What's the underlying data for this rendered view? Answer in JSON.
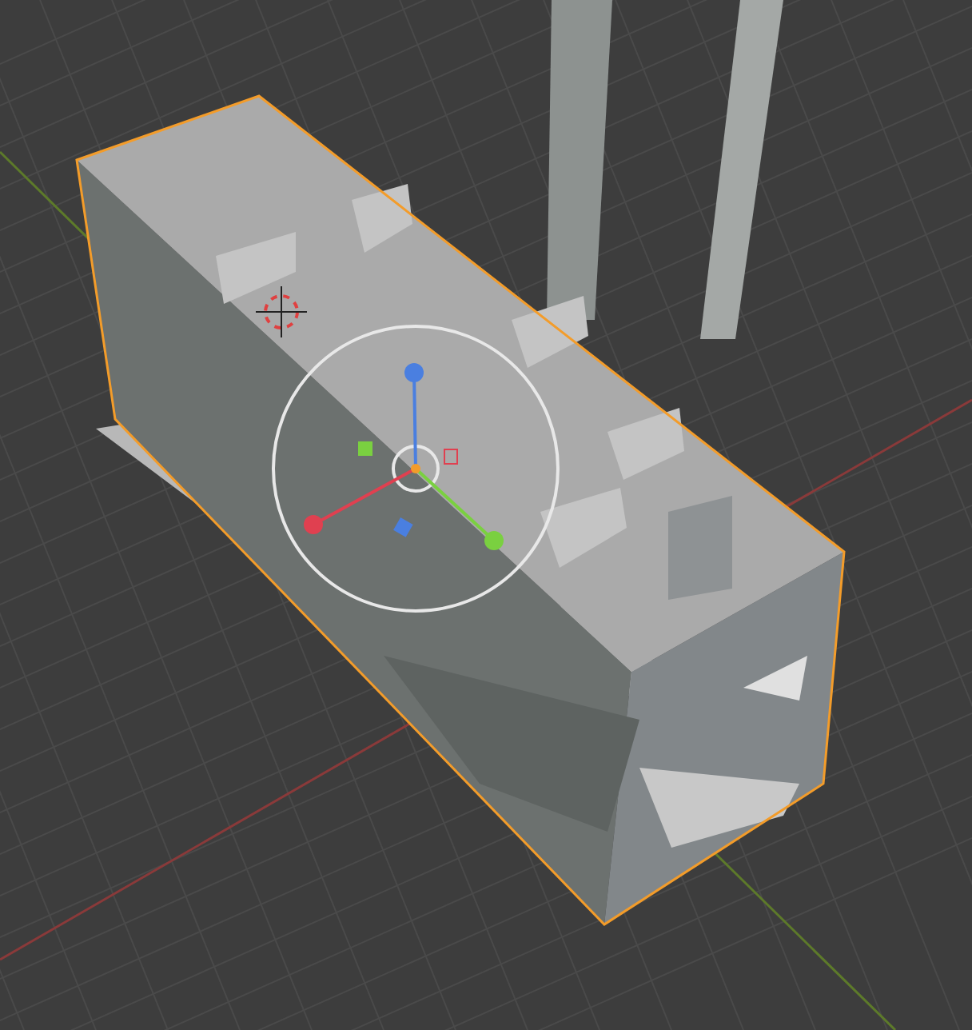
{
  "viewport": {
    "object_selected": true,
    "gizmo_visible": true
  }
}
